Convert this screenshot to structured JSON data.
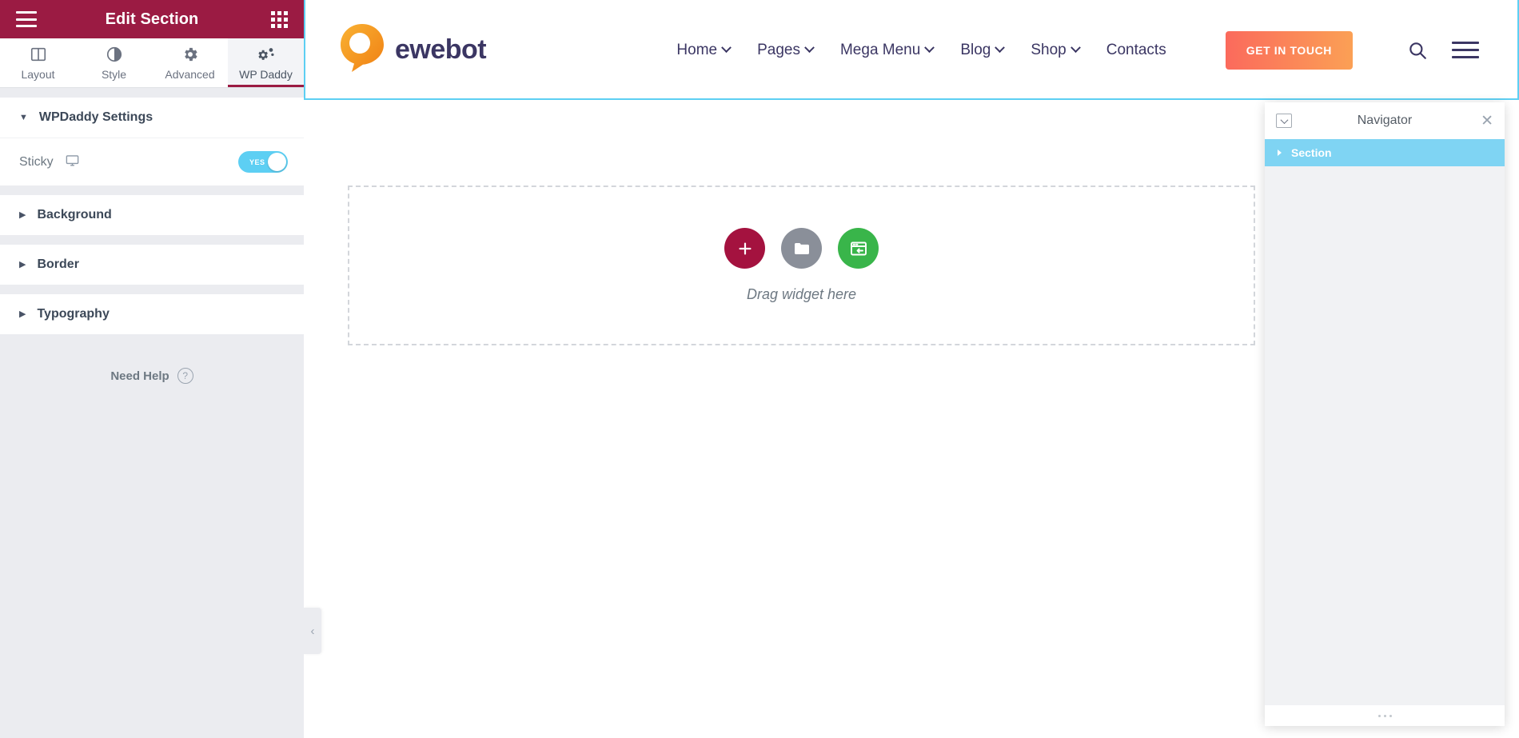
{
  "panel": {
    "header": {
      "title": "Edit Section",
      "menu_icon": "hamburger-icon",
      "apps_icon": "grid-icon"
    },
    "tabs": [
      {
        "label": "Layout",
        "icon": "layout-columns-icon",
        "active": false
      },
      {
        "label": "Style",
        "icon": "contrast-circle-icon",
        "active": false
      },
      {
        "label": "Advanced",
        "icon": "gear-icon",
        "active": false
      },
      {
        "label": "WP Daddy",
        "icon": "gears-icon",
        "active": true
      }
    ],
    "settings_section": {
      "title": "WPDaddy Settings",
      "expanded": true
    },
    "sticky": {
      "label": "Sticky",
      "device_icon": "desktop-monitor-icon",
      "toggle_value": "YES",
      "toggle_on": true
    },
    "collapsed_sections": [
      {
        "title": "Background",
        "expanded": false
      },
      {
        "title": "Border",
        "expanded": false
      },
      {
        "title": "Typography",
        "expanded": false
      }
    ],
    "need_help": {
      "label": "Need Help",
      "icon": "question-circle-icon"
    },
    "collapse_handle_icon": "chevron-left-icon"
  },
  "canvas": {
    "section_toolbar": {
      "add_icon": "plus-icon",
      "drag_icon": "drag-dots-icon",
      "close_icon": "close-icon"
    },
    "site_header": {
      "logo": {
        "text": "ewebot",
        "icon": "ewebot-teardrop-logo"
      },
      "nav_items": [
        {
          "label": "Home",
          "has_dropdown": true
        },
        {
          "label": "Pages",
          "has_dropdown": true
        },
        {
          "label": "Mega Menu",
          "has_dropdown": true
        },
        {
          "label": "Blog",
          "has_dropdown": true
        },
        {
          "label": "Shop",
          "has_dropdown": true
        },
        {
          "label": "Contacts",
          "has_dropdown": false
        }
      ],
      "cta_label": "GET IN TOUCH",
      "search_icon": "search-icon",
      "menu_icon": "hamburger-icon"
    },
    "dropzone": {
      "text": "Drag widget here",
      "buttons": [
        {
          "icon": "plus-icon",
          "name": "add-new-widget"
        },
        {
          "icon": "folder-icon",
          "name": "add-template"
        },
        {
          "icon": "template-import-icon",
          "name": "add-saved-section"
        }
      ]
    }
  },
  "navigator": {
    "title": "Navigator",
    "collapse_all_icon": "collapse-all-icon",
    "close_icon": "close-icon",
    "items": [
      {
        "label": "Section",
        "selected": true,
        "expandable": true
      }
    ],
    "resize_grip_icon": "resize-dots-icon"
  },
  "colors": {
    "panel_header": "#9b1b43",
    "accent_cyan": "#5dcff3",
    "cta_gradient_start": "#fb6a5c",
    "cta_gradient_end": "#fba055",
    "logo_orange": "#f5a623",
    "logo_text": "#3b3663",
    "add_widget": "#a4123f",
    "folder_btn": "#8a8f99",
    "template_btn": "#39b54a"
  }
}
